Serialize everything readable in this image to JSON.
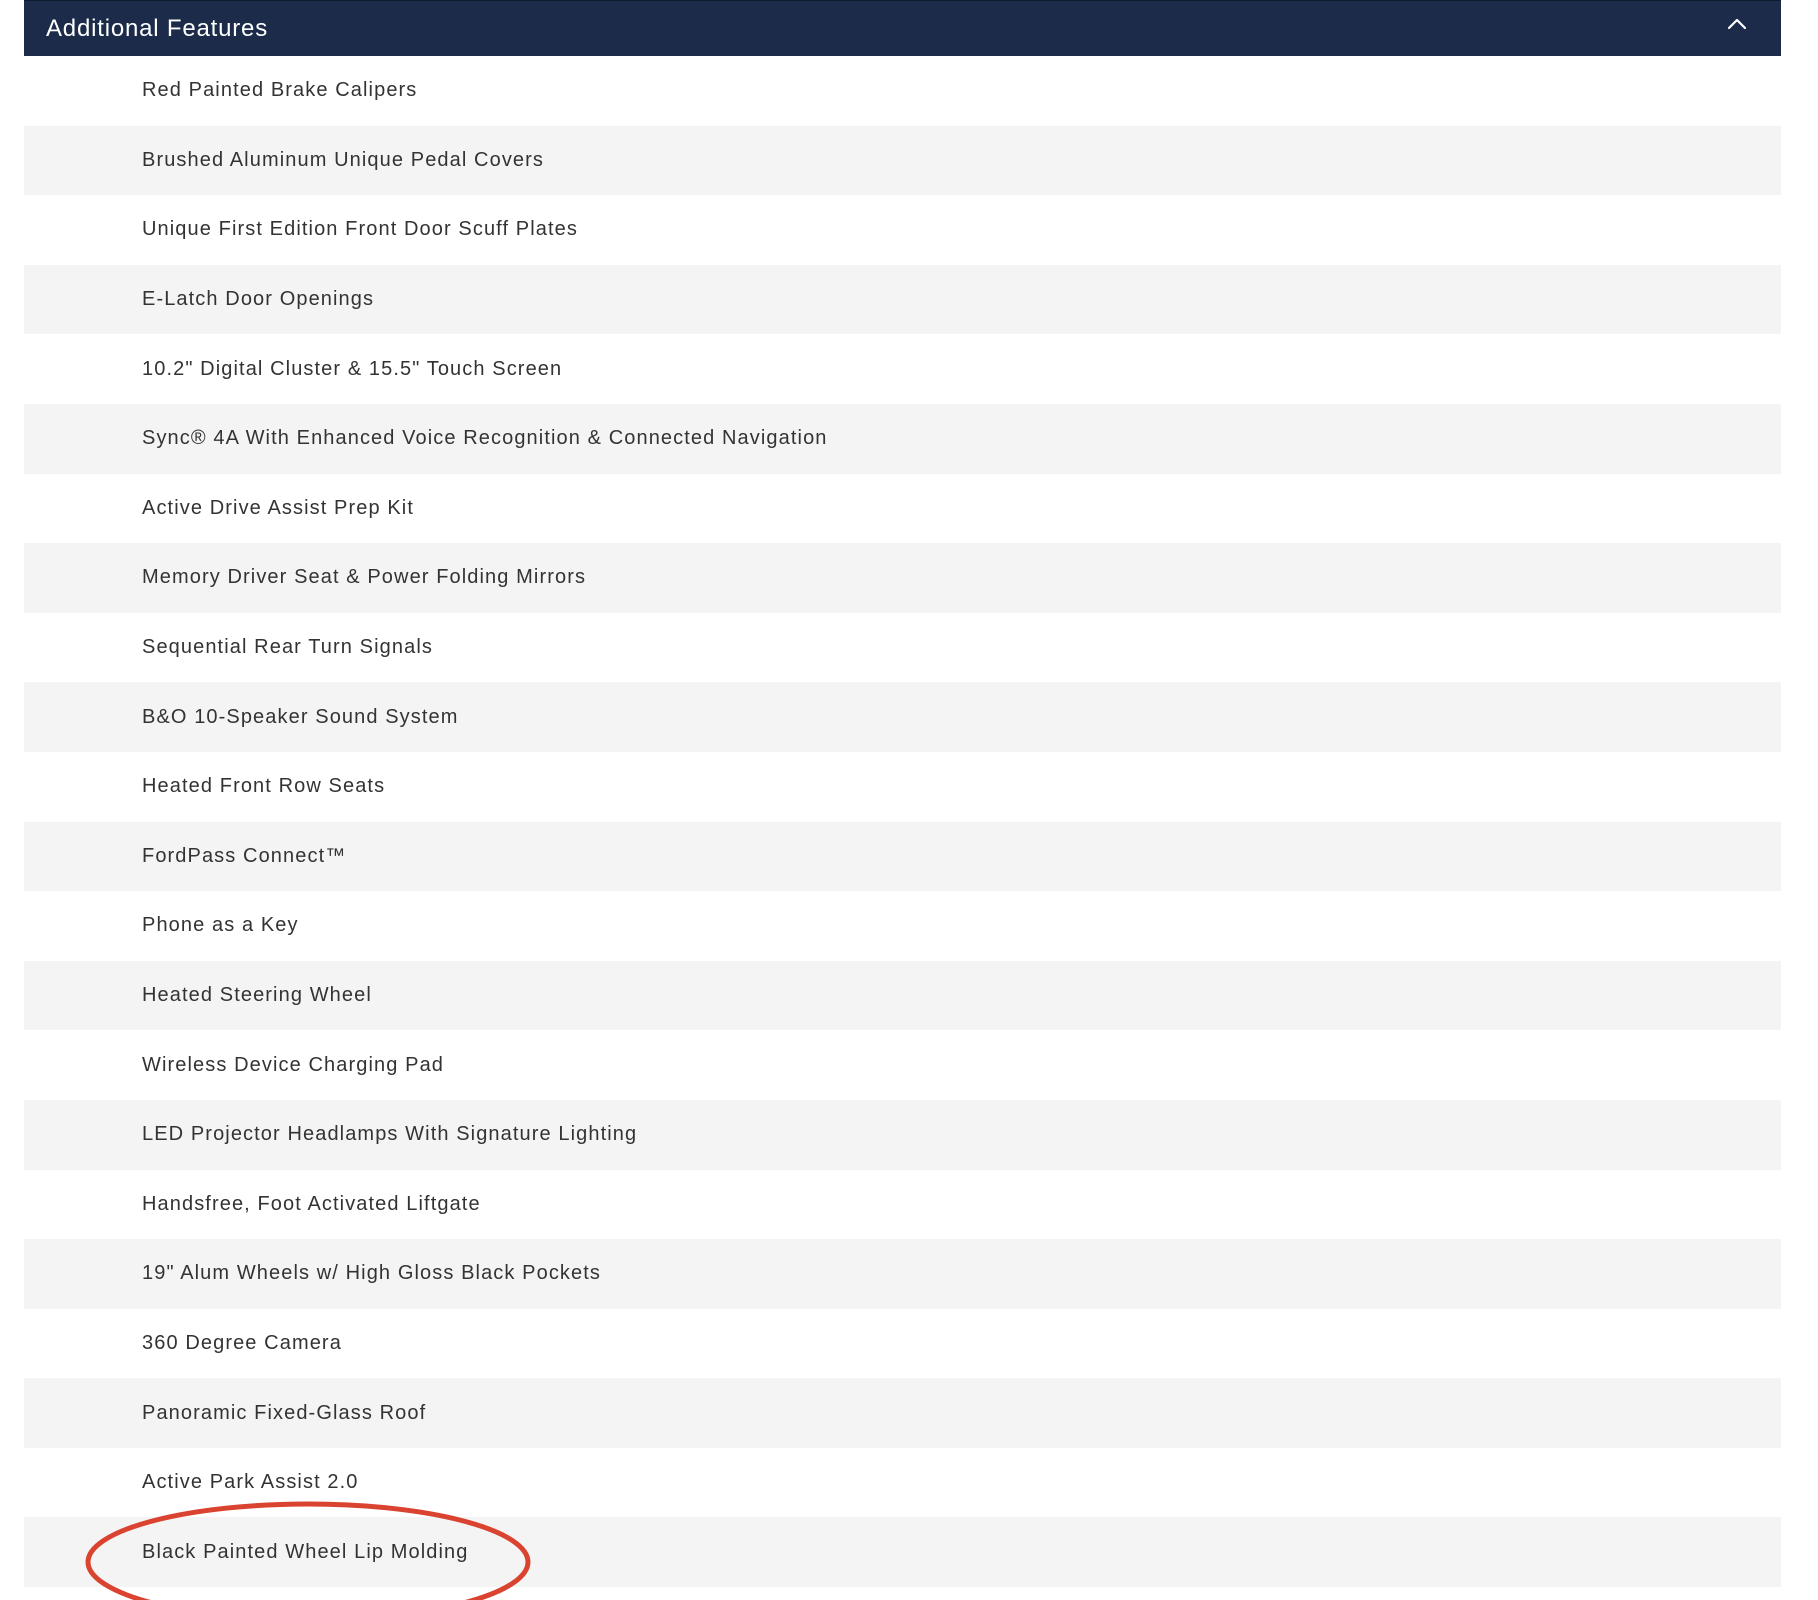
{
  "panel": {
    "title": "Additional Features",
    "toggle_icon": "chevron-up-icon"
  },
  "features": [
    "Red Painted Brake Calipers",
    "Brushed Aluminum Unique Pedal Covers",
    "Unique First Edition Front Door Scuff Plates",
    "E-Latch Door Openings",
    "10.2\" Digital Cluster & 15.5\" Touch Screen",
    "Sync® 4A With Enhanced Voice Recognition & Connected Navigation",
    "Active Drive Assist Prep Kit",
    "Memory Driver Seat & Power Folding Mirrors",
    "Sequential Rear Turn Signals",
    "B&O 10-Speaker Sound System",
    "Heated Front Row Seats",
    "FordPass Connect™",
    "Phone as a Key",
    "Heated Steering Wheel",
    "Wireless Device Charging Pad",
    "LED Projector Headlamps With Signature Lighting",
    "Handsfree, Foot Activated Liftgate",
    "19\" Alum Wheels w/ High Gloss Black Pockets",
    "360 Degree Camera",
    "Panoramic Fixed-Glass Roof",
    "Active Park Assist 2.0",
    "Black Painted Wheel Lip Molding"
  ],
  "colors": {
    "header_bg": "#1b2b49",
    "row_alt_bg": "#f4f4f4",
    "annotation_circle": "#d9432f"
  }
}
